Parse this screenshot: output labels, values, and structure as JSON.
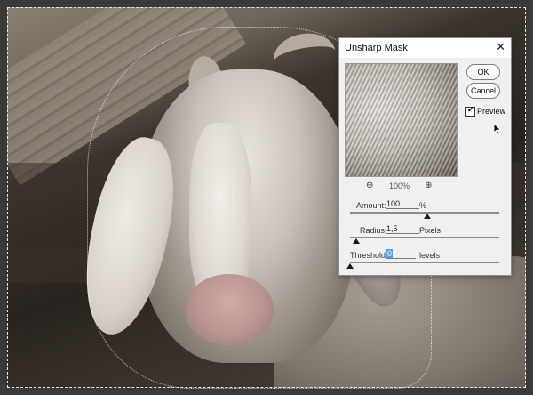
{
  "dialog": {
    "title": "Unsharp Mask",
    "ok_label": "OK",
    "cancel_label": "Cancel",
    "preview_label": "Preview",
    "preview_checked": true,
    "zoom_level": "100%",
    "amount": {
      "label": "Amount:",
      "value": "100",
      "unit": "%",
      "slider_fraction": 0.52
    },
    "radius": {
      "label": "Radius:",
      "value": "1,5",
      "unit": "Pixels",
      "slider_fraction": 0.04
    },
    "threshold": {
      "label": "Threshold:",
      "value": "0",
      "unit": "levels",
      "slider_fraction": 0.0
    }
  },
  "icons": {
    "close": "close-icon",
    "zoom_out": "zoom-out-icon",
    "zoom_in": "zoom-in-icon",
    "cursor": "mouse-pointer-icon"
  }
}
